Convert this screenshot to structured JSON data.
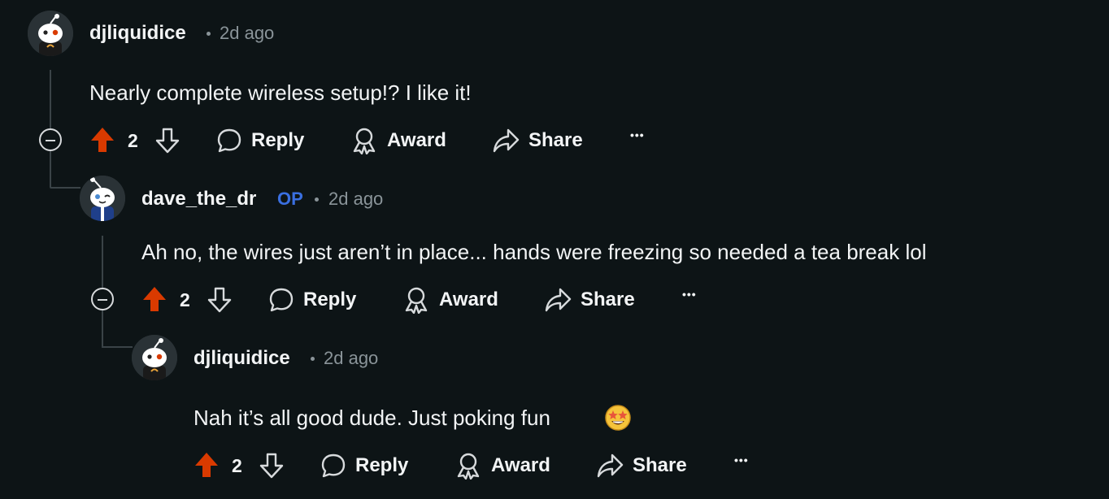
{
  "comments": [
    {
      "username": "djliquidice",
      "time": "2d ago",
      "body": "Nearly complete wireless setup!? I like it!",
      "score": "2",
      "avatar": "snoo-avatar"
    },
    {
      "username": "dave_the_dr",
      "op_badge": "OP",
      "time": "2d ago",
      "body": "Ah no, the wires just aren’t in place... hands were freezing so needed a tea break lol",
      "score": "2",
      "avatar": "snoo-avatar"
    },
    {
      "username": "djliquidice",
      "time": "2d ago",
      "body": "Nah it’s all good dude. Just poking fun",
      "emoji": "star-struck-emoji",
      "score": "2",
      "avatar": "snoo-avatar"
    }
  ],
  "actions": {
    "reply": "Reply",
    "award": "Award",
    "share": "Share",
    "more": "•••"
  },
  "colors": {
    "background": "#0d1416",
    "upvote_active": "#d93a00",
    "op_badge": "#3a6fe0",
    "muted": "#8a9499"
  }
}
